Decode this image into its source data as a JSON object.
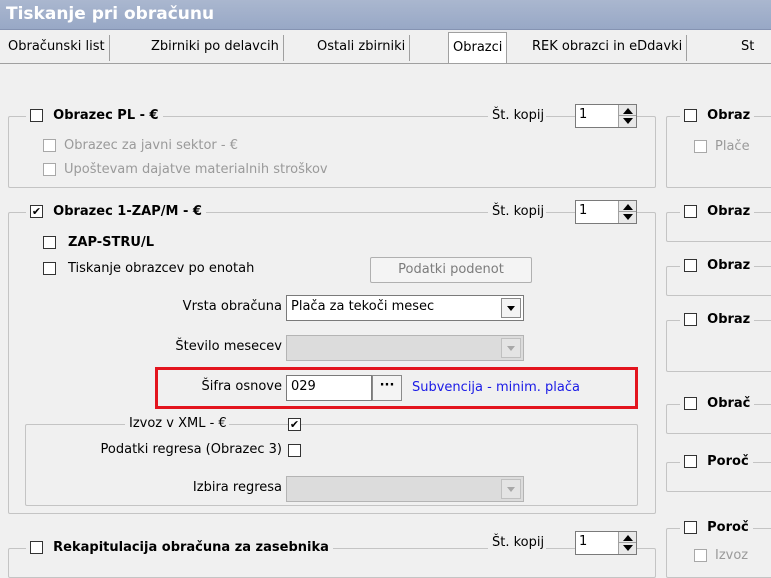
{
  "window": {
    "title": "Tiskanje pri obračunu"
  },
  "tabs": [
    {
      "label": "Obračunski list"
    },
    {
      "label": "Zbirniki po delavcih"
    },
    {
      "label": "Ostali zbirniki"
    },
    {
      "label": "Obrazci"
    },
    {
      "label": "REK obrazci  in eDdavki"
    },
    {
      "label": "St"
    }
  ],
  "obrazec_pl": {
    "title": "Obrazec PL - €",
    "copies_label": "Št. kopij",
    "copies_value": "1",
    "javni_sektor": "Obrazec za javni sektor - €",
    "dajatve": "Upoštevam dajatve materialnih stroškov"
  },
  "obrazec_1zap": {
    "title": "Obrazec 1-ZAP/M - €",
    "checked": true,
    "copies_label": "Št. kopij",
    "copies_value": "1",
    "zap_stru": "ZAP-STRU/L",
    "tiskanje_enot": "Tiskanje obrazcev po enotah",
    "podatki_button": "Podatki podenot",
    "vrsta_label": "Vrsta obračuna",
    "vrsta_value": "Plača za tekoči mesec",
    "stevilo_label": "Število mesecev",
    "sifra_label": "Šifra osnove",
    "sifra_value": "029",
    "sifra_button": "···",
    "sifra_desc": "Subvencija - minim. plača",
    "izvoz_label": "Izvoz v XML - €",
    "izvoz_checked": true,
    "regres_label": "Podatki regresa (Obrazec 3)",
    "izbira_label": "Izbira regresa"
  },
  "rekap": {
    "title": "Rekapitulacija obračuna za zasebnika",
    "copies_label": "Št. kopij",
    "copies_value": "1"
  },
  "right_column": [
    {
      "title": "Obraz"
    },
    {
      "title": "Plače"
    },
    {
      "title": "Obraz"
    },
    {
      "title": "Obraz"
    },
    {
      "title": "Obraz"
    },
    {
      "title": "Obrač"
    },
    {
      "title": "Poroč"
    },
    {
      "title": "Poroč"
    },
    {
      "title": "Izvoz"
    }
  ],
  "colors": {
    "highlight": "#e3141e",
    "link": "#1a1ae6",
    "title_bar": "#98a8c6"
  }
}
